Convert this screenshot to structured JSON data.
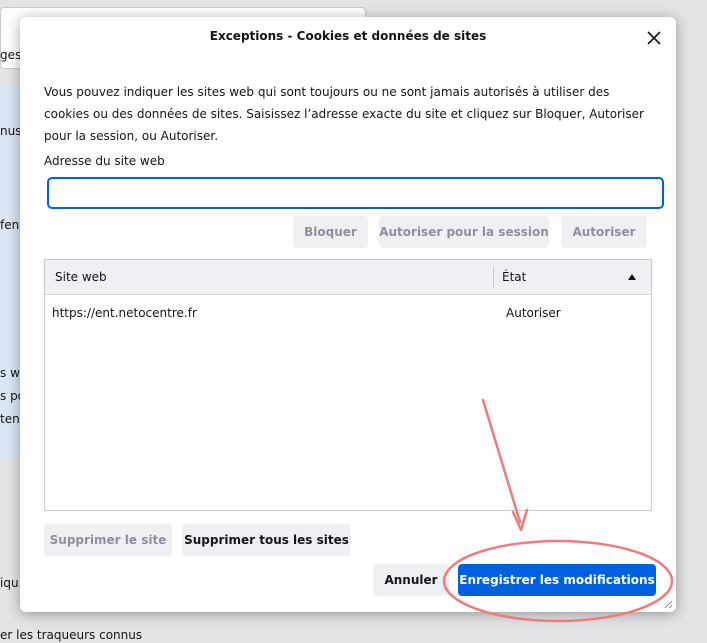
{
  "background": {
    "fragments": [
      "ges",
      "nus",
      "fen",
      "s we",
      "s po",
      "tenu",
      "iqu",
      "er les traqueurs connus"
    ]
  },
  "dialog": {
    "title": "Exceptions - Cookies et données de sites",
    "close_icon": "close-icon",
    "description": "Vous pouvez indiquer les sites web qui sont toujours ou ne sont jamais autorisés à utiliser des cookies ou des données de sites. Saisissez l’adresse exacte du site et cliquez sur Bloquer, Autoriser pour la session, ou Autoriser.",
    "address_label": "Adresse du site web",
    "address_value": "",
    "address_placeholder": "",
    "buttons": {
      "block": "Bloquer",
      "allow_session": "Autoriser pour la session",
      "allow": "Autoriser",
      "remove_site": "Supprimer le site",
      "remove_all": "Supprimer tous les sites",
      "cancel": "Annuler",
      "save": "Enregistrer les modifications"
    },
    "table": {
      "columns": [
        "Site web",
        "État"
      ],
      "sort_icon": "sort-ascending-icon",
      "rows": [
        {
          "site": "https://ent.netocentre.fr",
          "status": "Autoriser"
        }
      ]
    }
  },
  "colors": {
    "accent": "#0061e0",
    "annotation": "#f07a7a"
  }
}
